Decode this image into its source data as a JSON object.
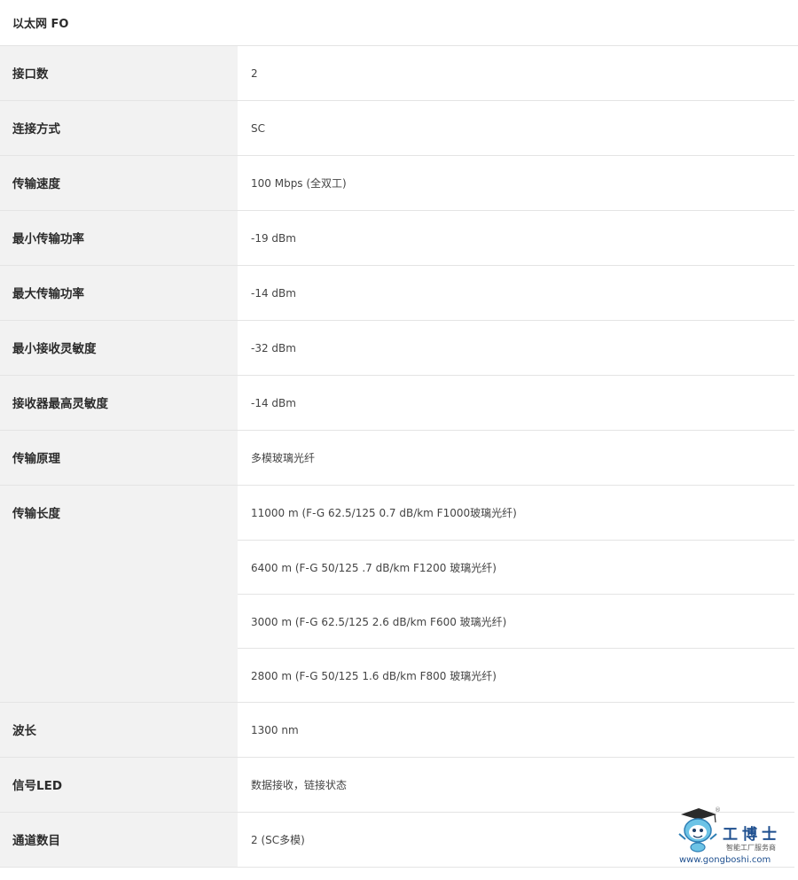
{
  "section_title": "以太网 FO",
  "rows": [
    {
      "label": "接口数",
      "values": [
        "2"
      ]
    },
    {
      "label": "连接方式",
      "values": [
        "SC"
      ]
    },
    {
      "label": "传输速度",
      "values": [
        "100 Mbps (全双工)"
      ]
    },
    {
      "label": "最小传输功率",
      "values": [
        "-19 dBm"
      ]
    },
    {
      "label": "最大传输功率",
      "values": [
        "-14 dBm"
      ]
    },
    {
      "label": "最小接收灵敏度",
      "values": [
        "-32 dBm"
      ]
    },
    {
      "label": "接收器最高灵敏度",
      "values": [
        "-14 dBm"
      ]
    },
    {
      "label": "传输原理",
      "values": [
        "多模玻璃光纤"
      ]
    },
    {
      "label": "传输长度",
      "values": [
        "11000 m (F-G 62.5/125 0.7 dB/km F1000玻璃光纤)",
        "6400 m (F-G 50/125 .7 dB/km F1200 玻璃光纤)",
        "3000 m (F-G 62.5/125 2.6 dB/km F600 玻璃光纤)",
        "2800 m (F-G 50/125 1.6 dB/km F800 玻璃光纤)"
      ]
    },
    {
      "label": "波长",
      "values": [
        "1300 nm"
      ]
    },
    {
      "label": "信号LED",
      "values": [
        "数据接收，链接状态"
      ]
    },
    {
      "label": "通道数目",
      "values": [
        "2 (SC多模)"
      ]
    }
  ],
  "watermark": {
    "brand_cn": "工博士",
    "tagline": "智能工厂服务商",
    "url": "www.gongboshi.com",
    "registered_mark": "®",
    "icon": "robot-mascot-icon"
  }
}
